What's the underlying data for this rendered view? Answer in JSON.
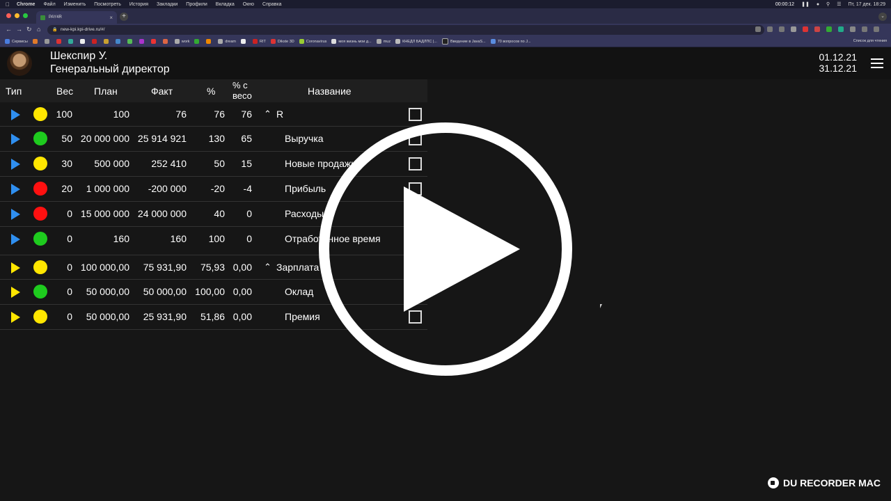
{
  "menubar": {
    "app": "Chrome",
    "items": [
      "Файл",
      "Изменить",
      "Посмотреть",
      "История",
      "Закладки",
      "Профили",
      "Вкладка",
      "Окно",
      "Справка"
    ],
    "recording_time": "00:00:12",
    "datetime": "Пт, 17 дек. 18:29"
  },
  "browser": {
    "tab_title": "PAY4R",
    "url": "new-kpi.kpi-drive.ru/#/",
    "bookmarks": [
      "Сервисы",
      "work",
      "dream",
      "RIT",
      "Dikste 3D",
      "Coronavirus",
      "моя жизнь мои д...",
      "muz",
      "КНЕДЛ БАДЛПС |...",
      "Введение в JavaS...",
      "70 вопросов по J..."
    ],
    "reading_list": "Список для чтения"
  },
  "header": {
    "user_name": "Шекспир У.",
    "user_role": "Генеральный директор",
    "date_from": "01.12.21",
    "date_to": "31.12.21"
  },
  "table": {
    "columns": {
      "type": "Тип",
      "weight": "Вес",
      "plan": "План",
      "fact": "Факт",
      "percent": "%",
      "percent_weight_1": "% с",
      "percent_weight_2": "весо",
      "name": "Название"
    },
    "rows": [
      {
        "type_color": "#2f8ff0",
        "status": "#ffe600",
        "weight": "100",
        "plan": "100",
        "fact": "76",
        "percent": "76",
        "percent_weight": "76",
        "name": "R",
        "expand": "^",
        "checkbox": true
      },
      {
        "type_color": "#2f8ff0",
        "status": "#1ecb1e",
        "weight": "50",
        "plan": "20 000 000",
        "fact": "25 914 921",
        "percent": "130",
        "percent_weight": "65",
        "name": "Выручка",
        "expand": "",
        "checkbox": true
      },
      {
        "type_color": "#2f8ff0",
        "status": "#ffe600",
        "weight": "30",
        "plan": "500 000",
        "fact": "252 410",
        "percent": "50",
        "percent_weight": "15",
        "name": "Новые продажи",
        "expand": "",
        "checkbox": true
      },
      {
        "type_color": "#2f8ff0",
        "status": "#ff1010",
        "weight": "20",
        "plan": "1 000 000",
        "fact": "-200 000",
        "percent": "-20",
        "percent_weight": "-4",
        "name": "Прибыль",
        "expand": "",
        "checkbox": true
      },
      {
        "type_color": "#2f8ff0",
        "status": "#ff1010",
        "weight": "0",
        "plan": "15 000 000",
        "fact": "24 000 000",
        "percent": "40",
        "percent_weight": "0",
        "name": "Расходы",
        "expand": "",
        "checkbox": true
      },
      {
        "type_color": "#2f8ff0",
        "status": "#1ecb1e",
        "weight": "0",
        "plan": "160",
        "fact": "160",
        "percent": "100",
        "percent_weight": "0",
        "name": "Отработанное время",
        "expand": "",
        "checkbox": false
      },
      {
        "type_color": "#ffe600",
        "status": "#ffe600",
        "weight": "0",
        "plan": "100 000,00",
        "fact": "75 931,90",
        "percent": "75,93",
        "percent_weight": "0,00",
        "name": "Зарплата",
        "expand": "^",
        "checkbox": false
      },
      {
        "type_color": "#ffe600",
        "status": "#1ecb1e",
        "weight": "0",
        "plan": "50 000,00",
        "fact": "50 000,00",
        "percent": "100,00",
        "percent_weight": "0,00",
        "name": "Оклад",
        "expand": "",
        "checkbox": false
      },
      {
        "type_color": "#ffe600",
        "status": "#ffe600",
        "weight": "0",
        "plan": "50 000,00",
        "fact": "25 931,90",
        "percent": "51,86",
        "percent_weight": "0,00",
        "name": "Премия",
        "expand": "",
        "checkbox": true
      }
    ]
  },
  "watermark": "DU RECORDER MAC"
}
